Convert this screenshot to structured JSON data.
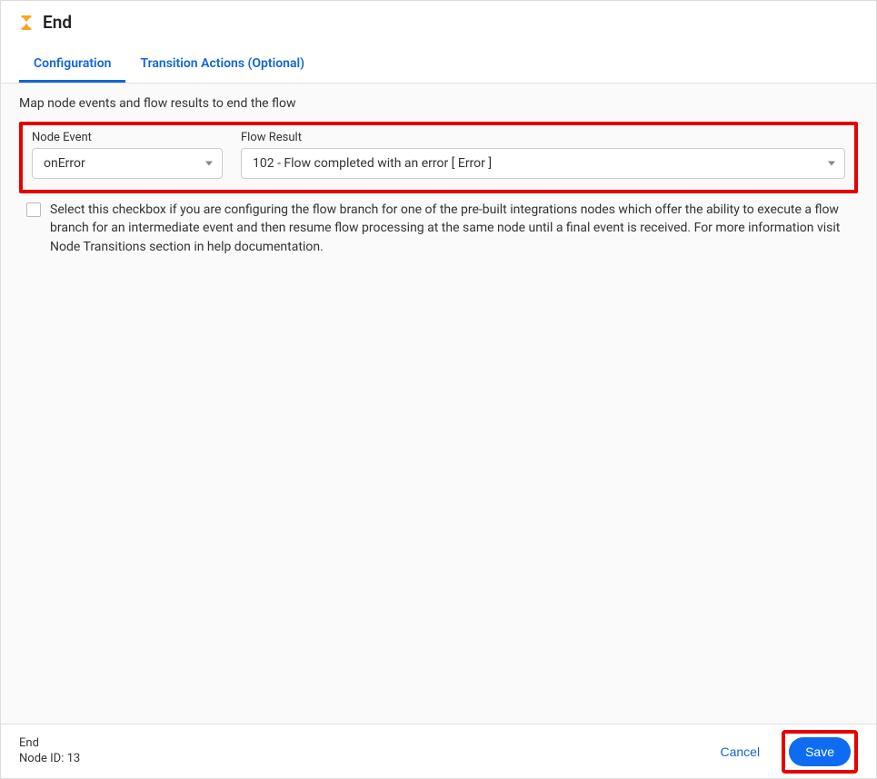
{
  "header": {
    "title": "End"
  },
  "tabs": {
    "configuration": "Configuration",
    "transition": "Transition Actions (Optional)"
  },
  "content": {
    "description": "Map node events and flow results to end the flow",
    "node_event_label": "Node Event",
    "node_event_value": "onError",
    "flow_result_label": "Flow Result",
    "flow_result_value": "102 - Flow completed with an error [ Error ]",
    "checkbox_text": "Select this checkbox if you are configuring the flow branch for one of the pre-built integrations nodes which offer the ability to execute a flow branch for an intermediate event and then resume flow processing at the same node until a final event is received. For more information visit Node Transitions section in help documentation."
  },
  "footer": {
    "name": "End",
    "node_id_label": "Node ID: 13",
    "cancel": "Cancel",
    "save": "Save"
  }
}
